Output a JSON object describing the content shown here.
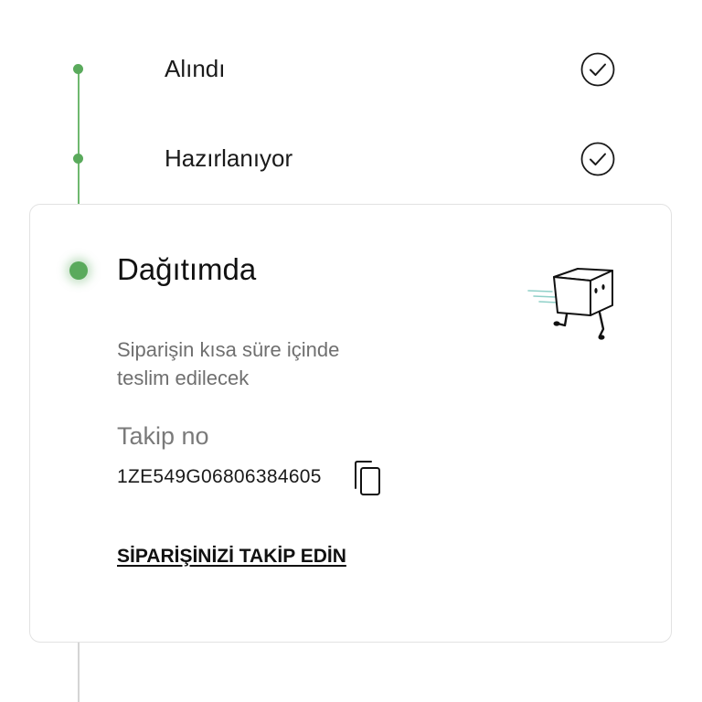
{
  "timeline": {
    "steps": [
      {
        "label": "Alındı",
        "status": "done"
      },
      {
        "label": "Hazırlanıyor",
        "status": "done"
      }
    ],
    "active": {
      "title": "Dağıtımda",
      "description": "Siparişin kısa süre içinde teslim edilecek",
      "tracking_label": "Takip no",
      "tracking_number": "1ZE549G06806384605",
      "track_link_label": "SİPARİŞİNİZİ TAKİP EDİN"
    }
  },
  "colors": {
    "accent_green": "#5aaa5c",
    "rail_gray": "#d4d4d4",
    "muted_text": "#6f6f6f"
  },
  "icons": {
    "done_step": "check-circle-icon",
    "copy": "copy-icon",
    "illustration": "running-box-illustration"
  }
}
